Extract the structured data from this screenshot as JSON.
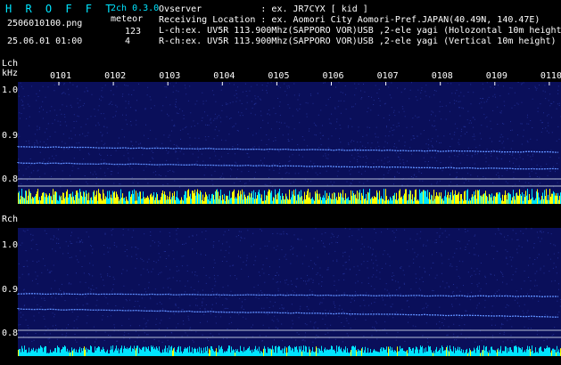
{
  "header": {
    "app_title": "H R O F F T",
    "filename": "2506010100.png",
    "timestamp": "25.06.01 01:00",
    "mode": "2ch 0.3.0",
    "meteor_label": "meteor",
    "meteor_count_l": "123",
    "meteor_count_r": "4",
    "observer_line": "Ovserver           : ex. JR7CYX [ kid ]",
    "location_line": "Receiving Location : ex. Aomori City Aomori-Pref.JAPAN(40.49N, 140.47E)",
    "lch_line": "L-ch:ex. UV5R 113.900Mhz(SAPPORO VOR)USB ,2-ele yagi (Holozontal 10m height)",
    "rch_line": "R-ch:ex. UV5R 113.900Mhz(SAPPORO VOR)USB ,2-ele yagi (Vertical 10m height)"
  },
  "time_ticks": [
    "0101",
    "0102",
    "0103",
    "0104",
    "0105",
    "0106",
    "0107",
    "0108",
    "0109",
    "0110"
  ],
  "lch": {
    "label": "Lch",
    "unit": "kHz",
    "freq_ticks": [
      "1.0",
      "0.9",
      "0.8"
    ]
  },
  "rch": {
    "label": "Rch",
    "freq_ticks": [
      "1.0",
      "0.9",
      "0.8"
    ]
  },
  "colors": {
    "background": "#000000",
    "spectrogram": "#0a0f5a",
    "signal_trace": "#6aa0ff",
    "level_bar_cyan": "#00e5ff",
    "level_bar_yellow": "#ffff00",
    "text_cyan": "#00e5ff"
  }
}
